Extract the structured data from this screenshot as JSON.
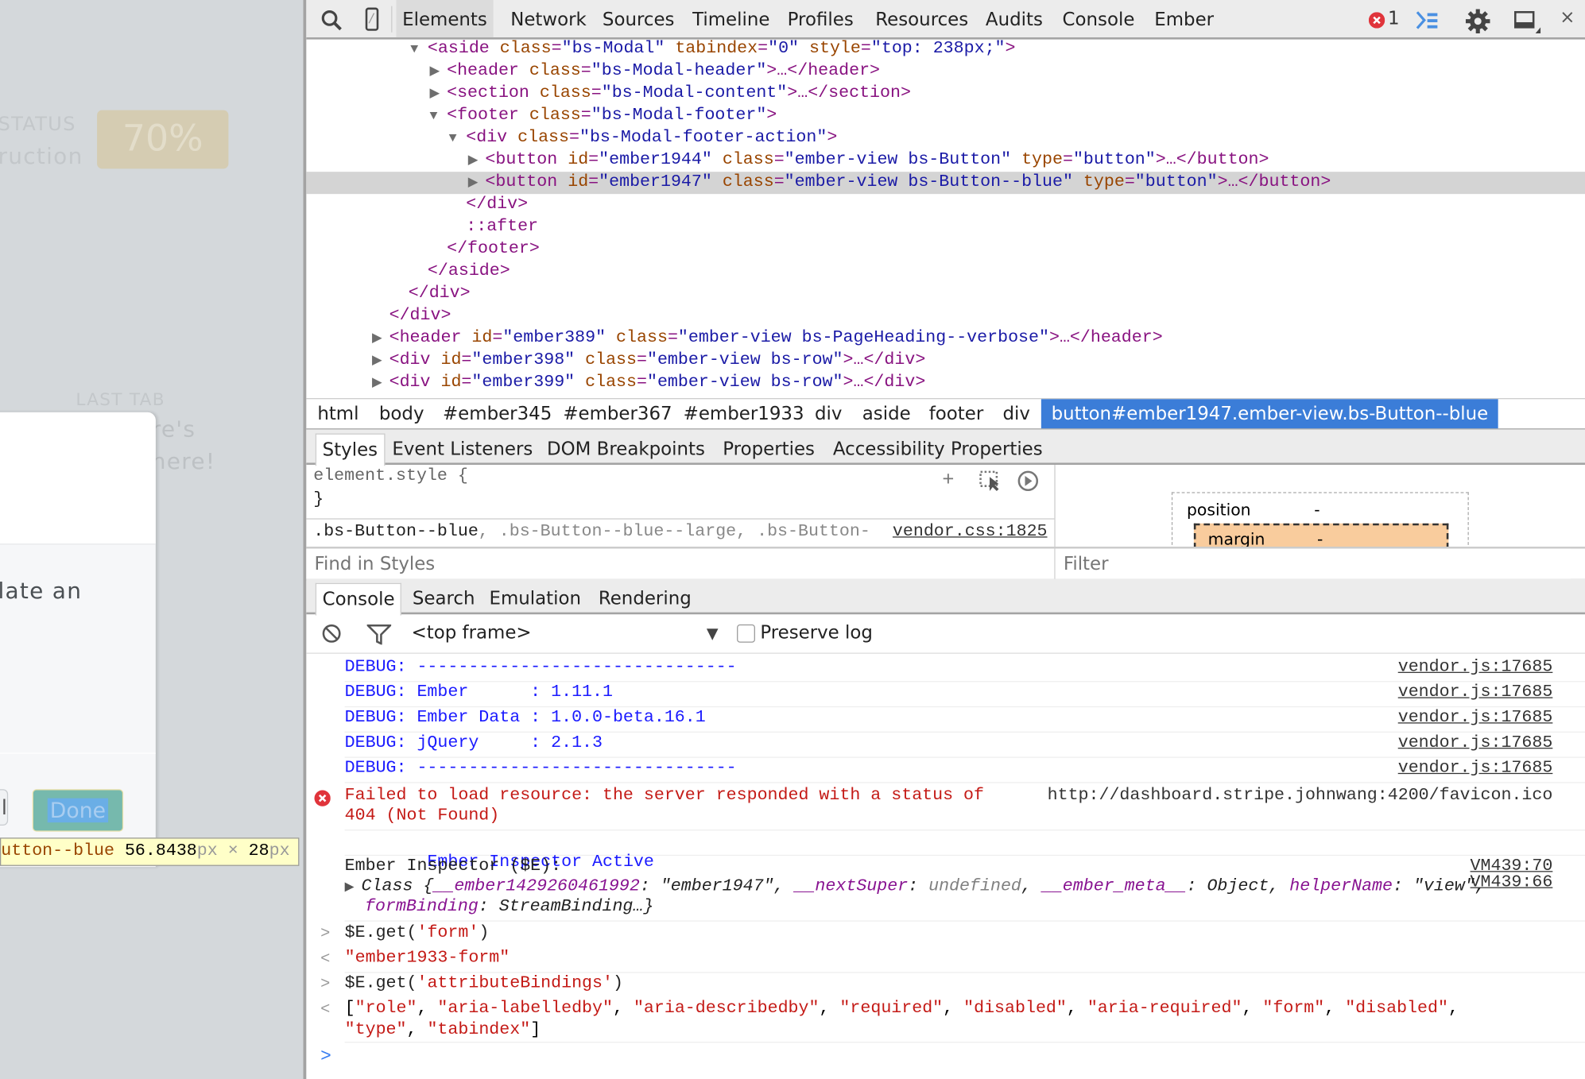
{
  "page": {
    "status_label": "STATUS",
    "status_sub": "ruction",
    "progress_badge": "70%",
    "progress_percent": 70,
    "last_tab_label": "LAST TAB",
    "last_tab_line1": "re's",
    "last_tab_line2": "here!",
    "modal_text": "late an",
    "cancel_partial": "l",
    "done_label": "Done",
    "tooltip_selector": "utton--blue",
    "tooltip_width": "56.8438",
    "tooltip_height": "28",
    "tooltip_unit": "px",
    "tooltip_times": "×"
  },
  "toolbar": {
    "tabs": [
      "Elements",
      "Network",
      "Sources",
      "Timeline",
      "Profiles",
      "Resources",
      "Audits",
      "Console",
      "Ember"
    ],
    "selected": "Elements",
    "error_count": "1",
    "icons": [
      "search-icon",
      "device-mode-icon",
      "error-icon",
      "console-drawer-icon",
      "gear-icon",
      "dock-icon",
      "close-icon"
    ]
  },
  "tree": [
    {
      "arrow": "▼",
      "indent": 3,
      "tokens": [
        [
          "tag",
          "<aside "
        ],
        [
          "an",
          "class"
        ],
        [
          "tag",
          "="
        ],
        [
          "av",
          "\"bs-Modal\""
        ],
        [
          "an",
          " tabindex"
        ],
        [
          "tag",
          "="
        ],
        [
          "av",
          "\"0\""
        ],
        [
          "an",
          " style"
        ],
        [
          "tag",
          "="
        ],
        [
          "av",
          "\"top: 238px;\""
        ],
        [
          "tag",
          ">"
        ]
      ]
    },
    {
      "arrow": "▶",
      "indent": 4,
      "tokens": [
        [
          "tag",
          "<header "
        ],
        [
          "an",
          "class"
        ],
        [
          "tag",
          "="
        ],
        [
          "av",
          "\"bs-Modal-header\""
        ],
        [
          "tag",
          ">…</header>"
        ]
      ]
    },
    {
      "arrow": "▶",
      "indent": 4,
      "tokens": [
        [
          "tag",
          "<section "
        ],
        [
          "an",
          "class"
        ],
        [
          "tag",
          "="
        ],
        [
          "av",
          "\"bs-Modal-content\""
        ],
        [
          "tag",
          ">…</section>"
        ]
      ]
    },
    {
      "arrow": "▼",
      "indent": 4,
      "tokens": [
        [
          "tag",
          "<footer "
        ],
        [
          "an",
          "class"
        ],
        [
          "tag",
          "="
        ],
        [
          "av",
          "\"bs-Modal-footer\""
        ],
        [
          "tag",
          ">"
        ]
      ]
    },
    {
      "arrow": "▼",
      "indent": 5,
      "tokens": [
        [
          "tag",
          "<div "
        ],
        [
          "an",
          "class"
        ],
        [
          "tag",
          "="
        ],
        [
          "av",
          "\"bs-Modal-footer-action\""
        ],
        [
          "tag",
          ">"
        ]
      ]
    },
    {
      "arrow": "▶",
      "indent": 6,
      "tokens": [
        [
          "tag",
          "<button "
        ],
        [
          "an",
          "id"
        ],
        [
          "tag",
          "="
        ],
        [
          "av",
          "\"ember1944\""
        ],
        [
          "an",
          " class"
        ],
        [
          "tag",
          "="
        ],
        [
          "av",
          "\"ember-view bs-Button\""
        ],
        [
          "an",
          " type"
        ],
        [
          "tag",
          "="
        ],
        [
          "av",
          "\"button\""
        ],
        [
          "tag",
          ">…</button>"
        ]
      ]
    },
    {
      "arrow": "▶",
      "indent": 6,
      "selected": true,
      "tokens": [
        [
          "tag",
          "<button "
        ],
        [
          "an",
          "id"
        ],
        [
          "tag",
          "="
        ],
        [
          "av",
          "\"ember1947\""
        ],
        [
          "an",
          " class"
        ],
        [
          "tag",
          "="
        ],
        [
          "av",
          "\"ember-view bs-Button--blue\""
        ],
        [
          "an",
          " type"
        ],
        [
          "tag",
          "="
        ],
        [
          "av",
          "\"button\""
        ],
        [
          "tag",
          ">…</button>"
        ]
      ]
    },
    {
      "arrow": "",
      "indent": 5,
      "tokens": [
        [
          "tag",
          "</div>"
        ]
      ]
    },
    {
      "arrow": "",
      "indent": 5,
      "tokens": [
        [
          "tag",
          "::after"
        ]
      ]
    },
    {
      "arrow": "",
      "indent": 4,
      "tokens": [
        [
          "tag",
          "</footer>"
        ]
      ]
    },
    {
      "arrow": "",
      "indent": 3,
      "tokens": [
        [
          "tag",
          "</aside>"
        ]
      ]
    },
    {
      "arrow": "",
      "indent": 2,
      "tokens": [
        [
          "tag",
          "</div>"
        ]
      ]
    },
    {
      "arrow": "",
      "indent": 1,
      "tokens": [
        [
          "tag",
          "</div>"
        ]
      ]
    },
    {
      "arrow": "▶",
      "indent": 1,
      "tokens": [
        [
          "tag",
          "<header "
        ],
        [
          "an",
          "id"
        ],
        [
          "tag",
          "="
        ],
        [
          "av",
          "\"ember389\""
        ],
        [
          "an",
          " class"
        ],
        [
          "tag",
          "="
        ],
        [
          "av",
          "\"ember-view bs-PageHeading--verbose\""
        ],
        [
          "tag",
          ">…</header>"
        ]
      ]
    },
    {
      "arrow": "▶",
      "indent": 1,
      "tokens": [
        [
          "tag",
          "<div "
        ],
        [
          "an",
          "id"
        ],
        [
          "tag",
          "="
        ],
        [
          "av",
          "\"ember398\""
        ],
        [
          "an",
          " class"
        ],
        [
          "tag",
          "="
        ],
        [
          "av",
          "\"ember-view bs-row\""
        ],
        [
          "tag",
          ">…</div>"
        ]
      ]
    },
    {
      "arrow": "▶",
      "indent": 1,
      "tokens": [
        [
          "tag",
          "<div "
        ],
        [
          "an",
          "id"
        ],
        [
          "tag",
          "="
        ],
        [
          "av",
          "\"ember399\""
        ],
        [
          "an",
          " class"
        ],
        [
          "tag",
          "="
        ],
        [
          "av",
          "\"ember-view bs-row\""
        ],
        [
          "tag",
          ">…</div>"
        ]
      ]
    }
  ],
  "breadcrumbs": [
    "html",
    "body",
    "#ember345",
    "#ember367",
    "#ember1933",
    "div",
    "aside",
    "footer",
    "div",
    "button#ember1947.ember-view.bs-Button--blue"
  ],
  "sidebar_tabs": [
    "Styles",
    "Event Listeners",
    "DOM Breakpoints",
    "Properties",
    "Accessibility Properties"
  ],
  "styles": {
    "element_style_open": "element.style {",
    "element_style_close": "}",
    "rule_selector": ".bs-Button--blue",
    "rule_rest": ", .bs-Button--blue--large, .bs-Button-",
    "rule_source": "vendor.css:1825",
    "find_placeholder": "Find in Styles",
    "filter_placeholder": "Filter",
    "box_position_label": "position",
    "box_position_value": "-",
    "box_margin_label": "margin",
    "box_margin_value": "-"
  },
  "drawer_tabs": [
    "Console",
    "Search",
    "Emulation",
    "Rendering"
  ],
  "console_toolbar": {
    "frame": "<top frame>",
    "preserve_log": "Preserve log",
    "preserve_checked": false
  },
  "console": {
    "debug": [
      {
        "text": "DEBUG: -------------------------------",
        "src": "vendor.js:17685"
      },
      {
        "text": "DEBUG: Ember      : 1.11.1",
        "src": "vendor.js:17685"
      },
      {
        "text": "DEBUG: Ember Data : 1.0.0-beta.16.1",
        "src": "vendor.js:17685"
      },
      {
        "text": "DEBUG: jQuery     : 2.1.3",
        "src": "vendor.js:17685"
      },
      {
        "text": "DEBUG: -------------------------------",
        "src": "vendor.js:17685"
      }
    ],
    "error_line1": "Failed to load resource: the server responded with a status of",
    "error_line2": "404 (Not Found)",
    "error_src": "http://dashboard.stripe.johnwang:4200/favicon.ico",
    "inspector_active": "Ember Inspector Active",
    "inspector_active_src": "VM439:66",
    "inspector_label": "Ember Inspector ($E):",
    "inspector_label_src": "VM439:70",
    "obj_class": "Class {",
    "obj_k1": "__ember1429260461992",
    "obj_v1": "\"ember1947\"",
    "obj_k2": "__nextSuper",
    "obj_v2": "undefined",
    "obj_k3": "__ember_meta__",
    "obj_v3": "Object",
    "obj_k4": "helperName",
    "obj_v4": "\"view\"",
    "obj_k5": "formBinding",
    "obj_v5": "StreamBinding…}",
    "cmd1_pre": "$E.get(",
    "cmd1_arg": "'form'",
    "cmd1_post": ")",
    "res1": "\"ember1933-form\"",
    "cmd2_pre": "$E.get(",
    "cmd2_arg": "'attributeBindings'",
    "cmd2_post": ")",
    "res2_items": [
      "role",
      "aria-labelledby",
      "aria-describedby",
      "required",
      "disabled",
      "aria-required",
      "form",
      "disabled",
      "type",
      "tabindex"
    ],
    "prompt": ">"
  },
  "colors": {
    "accent": "#3b7dd8",
    "error": "#c41a16",
    "debug": "#1a1aff",
    "highlight": "#ffffc8",
    "done_button": "#76b9ad"
  }
}
